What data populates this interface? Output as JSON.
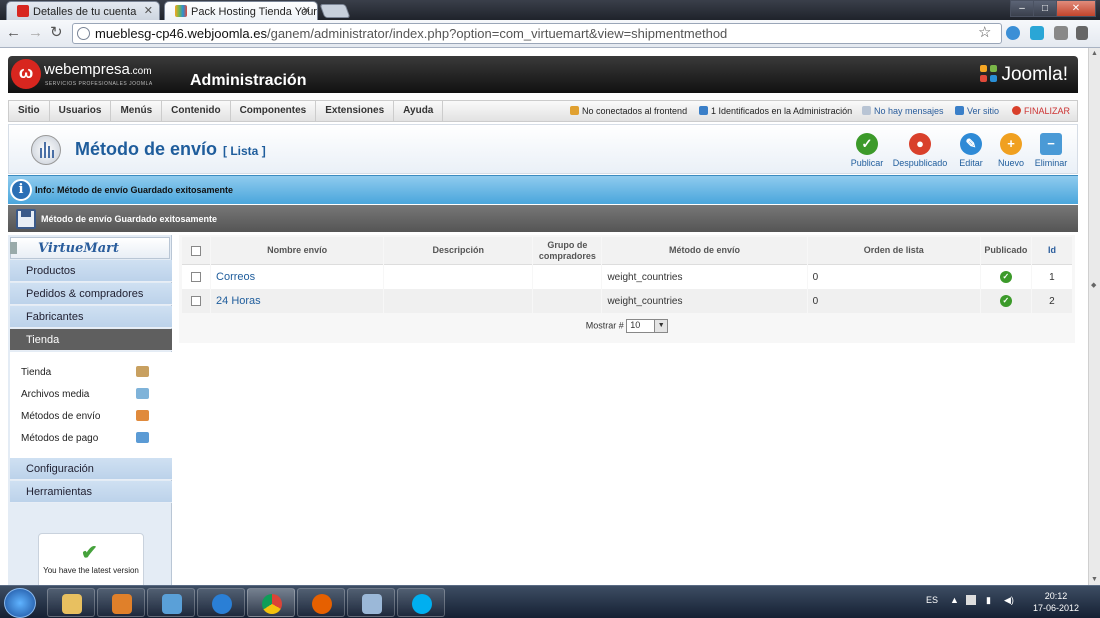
{
  "browser": {
    "tabs": [
      {
        "label": "Detalles de tu cuenta",
        "active": false
      },
      {
        "label": "Pack Hosting Tienda Yoursi",
        "active": true
      }
    ],
    "url_host": "mueblesg-cp46.webjoomla.es",
    "url_path": "/ganem/administrator/index.php?option=com_virtuemart&view=shipmentmethod"
  },
  "header": {
    "brand": "webempresa",
    "brand_suffix": ".com",
    "brand_sub": "SERVICIOS PROFESIONALES JOOMLA",
    "title": "Administración",
    "joomla": "Joomla!"
  },
  "menu": {
    "items": [
      "Sitio",
      "Usuarios",
      "Menús",
      "Contenido",
      "Componentes",
      "Extensiones",
      "Ayuda"
    ]
  },
  "status": {
    "frontend": "No conectados al frontend",
    "admin": "1 Identificados en la Administración",
    "messages": "No hay mensajes",
    "view_site": "Ver sitio",
    "logout": "FINALIZAR"
  },
  "toolbar": {
    "title": "Método de envío",
    "subtitle": "[ Lista ]",
    "buttons": [
      {
        "label": "Publicar",
        "color": "#3c9a2a",
        "glyph": "✓"
      },
      {
        "label": "Despublicado",
        "color": "#d9402b",
        "glyph": "●"
      },
      {
        "label": "Editar",
        "color": "#2e8ad6",
        "glyph": "✎"
      },
      {
        "label": "Nuevo",
        "color": "#f0a020",
        "glyph": "+"
      },
      {
        "label": "Eliminar",
        "color": "#4a9ad6",
        "glyph": "−"
      }
    ]
  },
  "info": {
    "icon": "i",
    "text": "Info: Método de envío Guardado exitosamente"
  },
  "message": {
    "text": "Método de envío Guardado exitosamente"
  },
  "sidebar": {
    "logo": "VirtueMart",
    "sections": [
      "Productos",
      "Pedidos & compradores",
      "Fabricantes",
      "Tienda"
    ],
    "active": "Tienda",
    "subitems": [
      "Tienda",
      "Archivos media",
      "Métodos de envío",
      "Métodos de pago"
    ],
    "sections2": [
      "Configuración",
      "Herramientas"
    ],
    "version_text": "You have the latest version"
  },
  "table": {
    "columns": {
      "name": "Nombre envío",
      "description": "Descripción",
      "group_line1": "Grupo de",
      "group_line2": "compradores",
      "method": "Método de envío",
      "order": "Orden de lista",
      "published": "Publicado",
      "id": "Id"
    },
    "rows": [
      {
        "name": "Correos",
        "description": "",
        "group": "",
        "method": "weight_countries",
        "order": "0",
        "published": true,
        "id": "1"
      },
      {
        "name": "24 Horas",
        "description": "",
        "group": "",
        "method": "weight_countries",
        "order": "0",
        "published": true,
        "id": "2"
      }
    ],
    "show_label": "Mostrar #",
    "show_value": "10"
  },
  "taskbar": {
    "lang": "ES",
    "time": "20:12",
    "date": "17-06-2012"
  }
}
